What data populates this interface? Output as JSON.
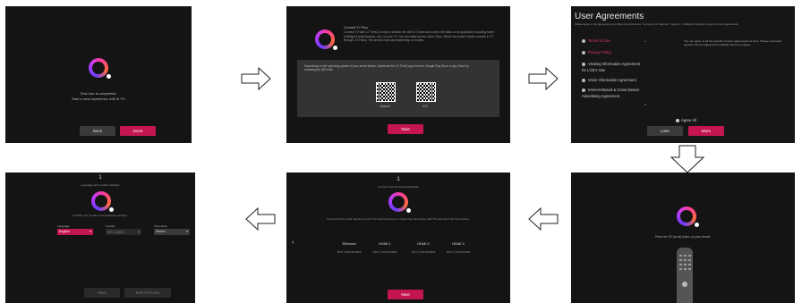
{
  "screen1": {
    "message_line1": "First Use is completed.",
    "message_line2": "Start a new experience with lit TV.",
    "back_label": "Back",
    "done_label": "Done"
  },
  "screen2": {
    "heading": "Connect TV Plus",
    "body": "Connect TV with LG ThinQ to enjoy a smarter life with AI. Check and control the status of all appliances including home. (Intelligent smart devices, etc.) on your TV. You can easily access Quick Tools. Select and match remote controls in TV through LG ThinQ. The service may vary depending on country.",
    "panel_text": "Depending on the operating system of your smart device, download the LG ThinQ app from the Google Play Store or App Store by scanning the QR code.",
    "qr1_label": "Android",
    "qr2_label": "iOS",
    "next_label": "Next"
  },
  "screen3": {
    "title": "User Agreements",
    "subtitle": "Please agree to the Agreement and follow the instructions. You can go to Settings > Support > Additional Settings to view the User Agreements.",
    "items": [
      {
        "label": "Terms of Use",
        "active": true
      },
      {
        "label": "Privacy Policy",
        "active": true
      },
      {
        "label": "Viewing Information Agreement for LGE's Use",
        "active": false
      },
      {
        "label": "Voice Information Agreement",
        "active": false
      },
      {
        "label": "Interest-Based & Cross-Device Advertising Agreement",
        "active": false
      }
    ],
    "right_text": "You can agree to all the specific consent agreements at once. Please read each specific consent agreement carefully before you agree.",
    "agree_all_label": "Agree All",
    "later_label": "Later",
    "more_label": "More"
  },
  "screen4": {
    "message": "Press the OK (scroll) button on your remote."
  },
  "screen5": {
    "step_number": "1",
    "step_caption": "Connect with Set Top Box/Satellite",
    "instruction": "Connect all the cable devices to your TV and turn them on. Check the connection with TV and select the Next button.",
    "inputs": [
      {
        "name": "Ethernet",
        "status": "Not Connected"
      },
      {
        "name": "HDMI 1",
        "status": "Not Connected"
      },
      {
        "name": "HDMI 2",
        "status": "Not Connected"
      },
      {
        "name": "HDMI 3",
        "status": "Not Connected"
      }
    ],
    "next_label": "Next"
  },
  "screen6": {
    "step_number": "1",
    "step_caption": "Language and Location Settings",
    "instruction": "Confirm your location and language settings.",
    "language_label": "Language",
    "language_value": "English",
    "country_label": "Country",
    "country_value": "Sri Lanka",
    "timezone_label": "Time Zone",
    "timezone_value": "Select...",
    "next_label": "Next",
    "exit_label": "Exit First Use"
  },
  "colors": {
    "accent": "#c4164e",
    "screen_bg": "#141414"
  }
}
